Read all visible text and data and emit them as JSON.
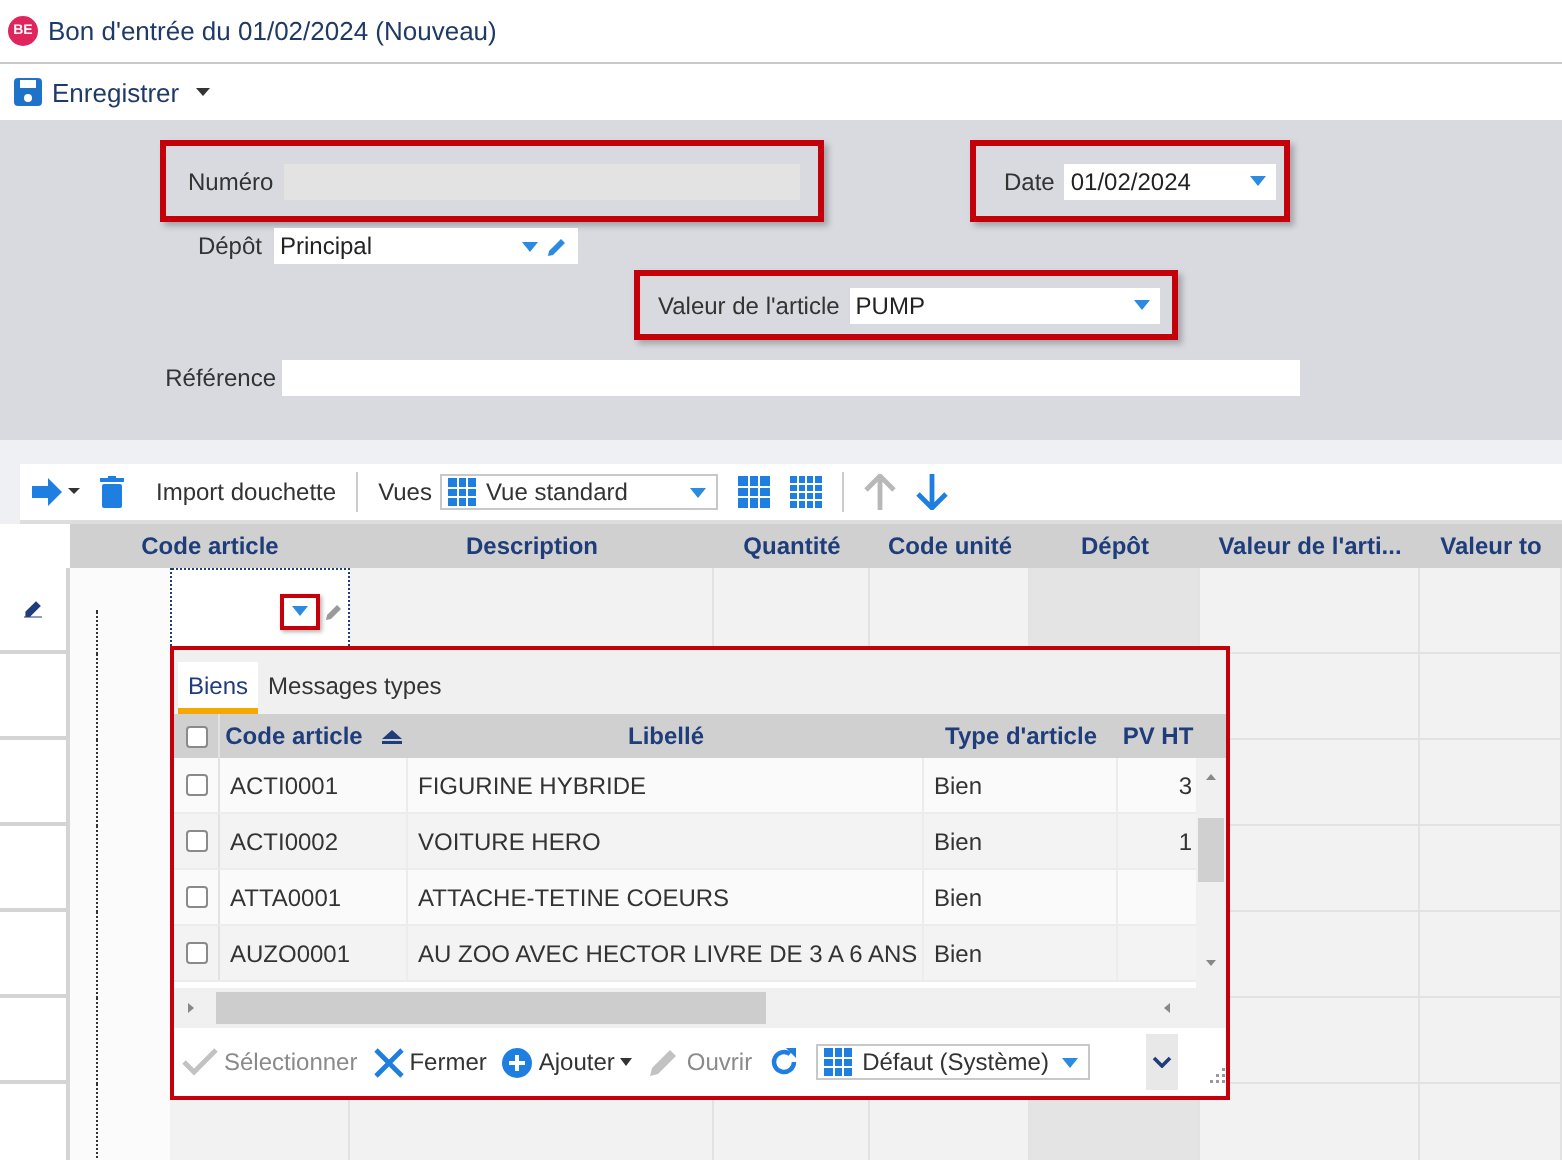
{
  "window": {
    "badge": "BE",
    "title": "Bon d'entrée du 01/02/2024 (Nouveau)"
  },
  "toolbar": {
    "save_label": "Enregistrer"
  },
  "form": {
    "numero": {
      "label": "Numéro",
      "highlighted": true,
      "disabled": true
    },
    "date": {
      "label": "Date",
      "value": "01/02/2024",
      "highlighted": true
    },
    "depot": {
      "label": "Dépôt",
      "value": "Principal",
      "highlighted": false
    },
    "valeur_article": {
      "label": "Valeur de l'article",
      "value": "PUMP",
      "highlighted": true
    },
    "reference": {
      "label": "Référence",
      "highlighted": false
    }
  },
  "grid_toolbar": {
    "import_label": "Import douchette",
    "views_label": "Vues",
    "view": "Vue standard",
    "move_up_disabled": true
  },
  "grid": {
    "columns": [
      {
        "label": "Code article",
        "readonly": false
      },
      {
        "label": "Description",
        "readonly": false
      },
      {
        "label": "Quantité",
        "readonly": false
      },
      {
        "label": "Code unité",
        "readonly": false
      },
      {
        "label": "Dépôt",
        "readonly": true
      },
      {
        "label": "Valeur de l'arti...",
        "readonly": false
      },
      {
        "label": "Valeur to",
        "readonly": false
      }
    ],
    "rows": [
      {
        "editing": true
      },
      {
        "editing": false
      },
      {
        "editing": false
      },
      {
        "editing": false
      },
      {
        "editing": false
      },
      {
        "editing": false
      },
      {
        "editing": false
      }
    ],
    "dropdown_highlighted": true
  },
  "popup": {
    "highlighted": true,
    "tabs": [
      {
        "label": "Biens",
        "selected": true
      },
      {
        "label": "Messages types",
        "selected": false
      }
    ],
    "all_checked": false,
    "columns": [
      {
        "label": "Code article",
        "sorted": true
      },
      {
        "label": "Libellé",
        "sorted": false
      },
      {
        "label": "Type d'article",
        "sorted": false
      },
      {
        "label": "PV HT",
        "sorted": false
      }
    ],
    "rows": [
      {
        "checked": false,
        "cells": [
          "ACTI0001",
          "FIGURINE HYBRIDE",
          "Bien",
          "3"
        ]
      },
      {
        "checked": false,
        "cells": [
          "ACTI0002",
          "VOITURE HERO",
          "Bien",
          "1"
        ]
      },
      {
        "checked": false,
        "cells": [
          "ATTA0001",
          "ATTACHE-TETINE COEURS",
          "Bien"
        ]
      },
      {
        "checked": false,
        "cells": [
          "AUZO0001",
          "AU ZOO AVEC HECTOR LIVRE DE 3 A 6 ANS",
          "Bien"
        ]
      }
    ],
    "actions": [
      {
        "kind": "select",
        "label": "Sélectionner",
        "disabled": true
      },
      {
        "kind": "close",
        "label": "Fermer",
        "disabled": false
      },
      {
        "kind": "add",
        "label": "Ajouter",
        "disabled": false
      },
      {
        "kind": "open",
        "label": "Ouvrir",
        "disabled": true
      }
    ],
    "layout": "Défaut (Système)"
  }
}
